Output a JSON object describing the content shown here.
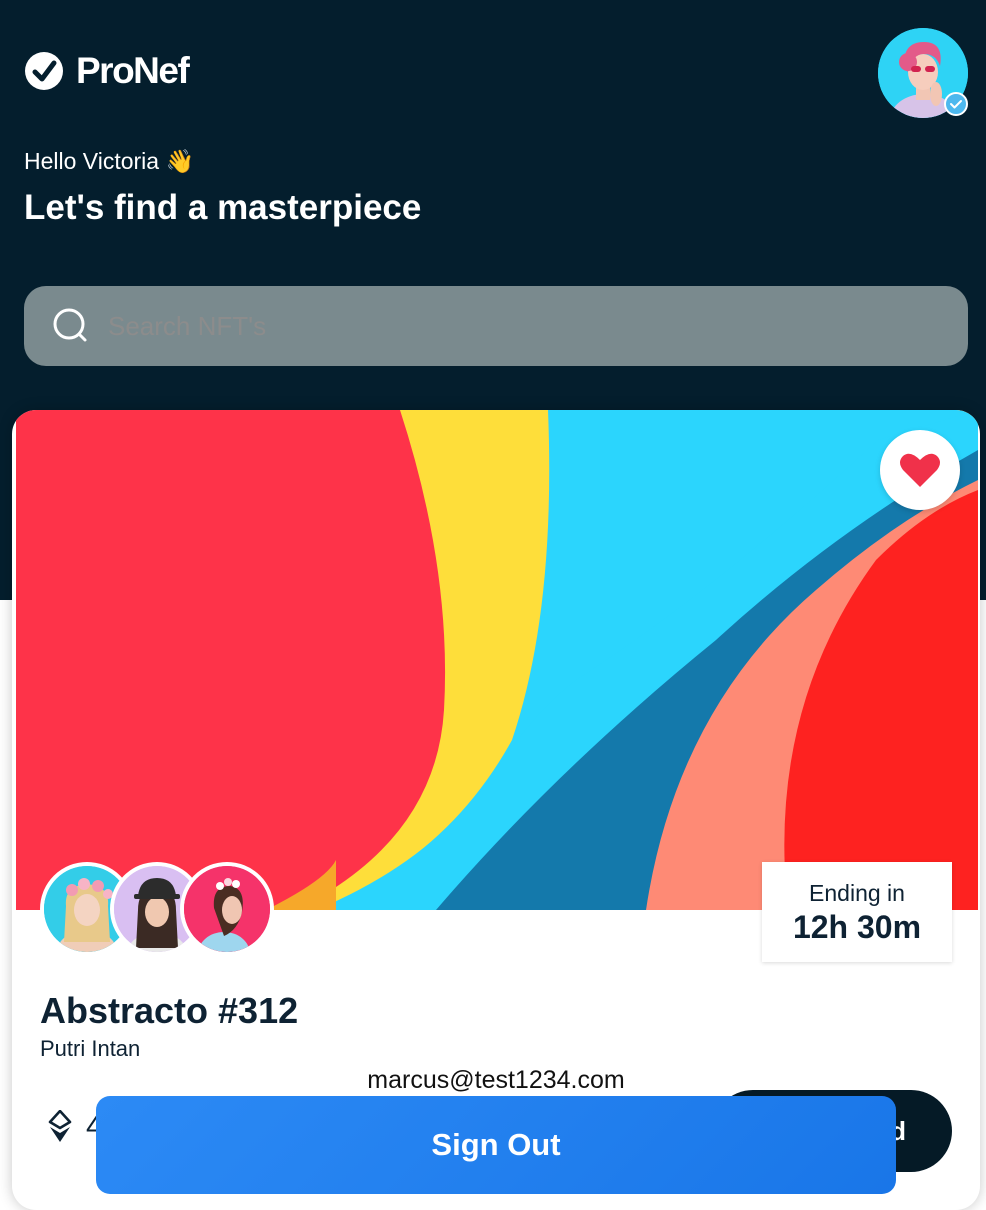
{
  "brand": {
    "name": "ProNef"
  },
  "header": {
    "greeting": "Hello Victoria 👋",
    "headline": "Let's find a masterpiece"
  },
  "search": {
    "placeholder": "Search NFT's",
    "value": ""
  },
  "nft_card": {
    "title": "Abstracto #312",
    "artist": "Putri Intan",
    "ending_label": "Ending in",
    "ending_value": "12h 30m",
    "price_partial": "4",
    "bid_button_partial": "d",
    "favorite": true
  },
  "user": {
    "email": "marcus@test1234.com",
    "verified": true
  },
  "actions": {
    "sign_out": "Sign Out"
  },
  "colors": {
    "header_bg": "#041e2d",
    "search_bg": "#7a8a8e",
    "heart": "#f0314a",
    "primary_button": "#1f7ff0",
    "dark_button": "#051a26"
  }
}
